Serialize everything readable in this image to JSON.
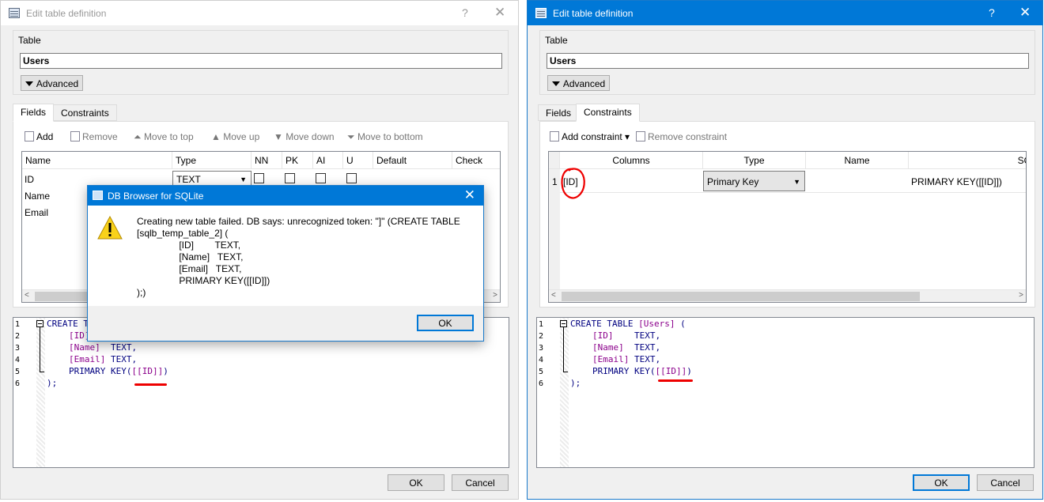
{
  "left_window": {
    "title": "Edit table definition",
    "help": "?",
    "close": "✕",
    "table_label": "Table",
    "table_name": "Users",
    "advanced_label": "Advanced",
    "tabs": [
      "Fields",
      "Constraints"
    ],
    "toolbar": [
      "Add",
      "Remove",
      "Move to top",
      "Move up",
      "Move down",
      "Move to bottom"
    ],
    "columns": [
      "Name",
      "Type",
      "NN",
      "PK",
      "AI",
      "U",
      "Default",
      "Check"
    ],
    "rows": [
      {
        "name": "ID",
        "type": "TEXT"
      },
      {
        "name": "Name"
      },
      {
        "name": "Email"
      }
    ],
    "code": {
      "line1_kw": "CREATE T",
      "line2_id": "[ID]",
      "line3_id": "[Name]",
      "line3_ty": "TEXT,",
      "line4_id": "[Email]",
      "line4_ty": "TEXT,",
      "line5_kw": "PRIMARY KEY(",
      "line5_id": "[[ID]]",
      "line5_end": ")",
      "line6": ");"
    },
    "ok_label": "OK",
    "cancel_label": "Cancel"
  },
  "dialog": {
    "title": "DB Browser for SQLite",
    "close": "✕",
    "message": "Creating new table failed. DB says: unrecognized token: \"]\" (CREATE TABLE\n[sqlb_temp_table_2] (\n                [ID]        TEXT,\n                [Name]   TEXT,\n                [Email]   TEXT,\n                PRIMARY KEY([[ID]])\n);)",
    "ok_label": "OK"
  },
  "right_window": {
    "title": "Edit table definition",
    "help": "?",
    "close": "✕",
    "table_label": "Table",
    "table_name": "Users",
    "advanced_label": "Advanced",
    "tabs": [
      "Fields",
      "Constraints"
    ],
    "toolbar": [
      "Add constraint",
      "Remove constraint"
    ],
    "columns": [
      "Columns",
      "Type",
      "Name",
      "SQ"
    ],
    "row": {
      "num": "1",
      "columns": "[ID]",
      "type": "Primary Key",
      "name": "",
      "sql": "PRIMARY KEY([[ID]])"
    },
    "code": {
      "line1_kw": "CREATE TABLE ",
      "line1_id": "[Users]",
      "line1_end": " (",
      "line2_id": "[ID]",
      "line2_ty": "TEXT,",
      "line3_id": "[Name]",
      "line3_ty": "TEXT,",
      "line4_id": "[Email]",
      "line4_ty": "TEXT,",
      "line5_kw": "PRIMARY KEY(",
      "line5_id": "[[ID]]",
      "line5_end": ")",
      "line6": ");"
    },
    "ok_label": "OK",
    "cancel_label": "Cancel"
  },
  "line_numbers": [
    "1",
    "2",
    "3",
    "4",
    "5",
    "6"
  ],
  "colors": {
    "accent": "#0078d7",
    "annotation_red": "#e00000",
    "identifier": "#8b008b",
    "keyword": "#000080"
  }
}
